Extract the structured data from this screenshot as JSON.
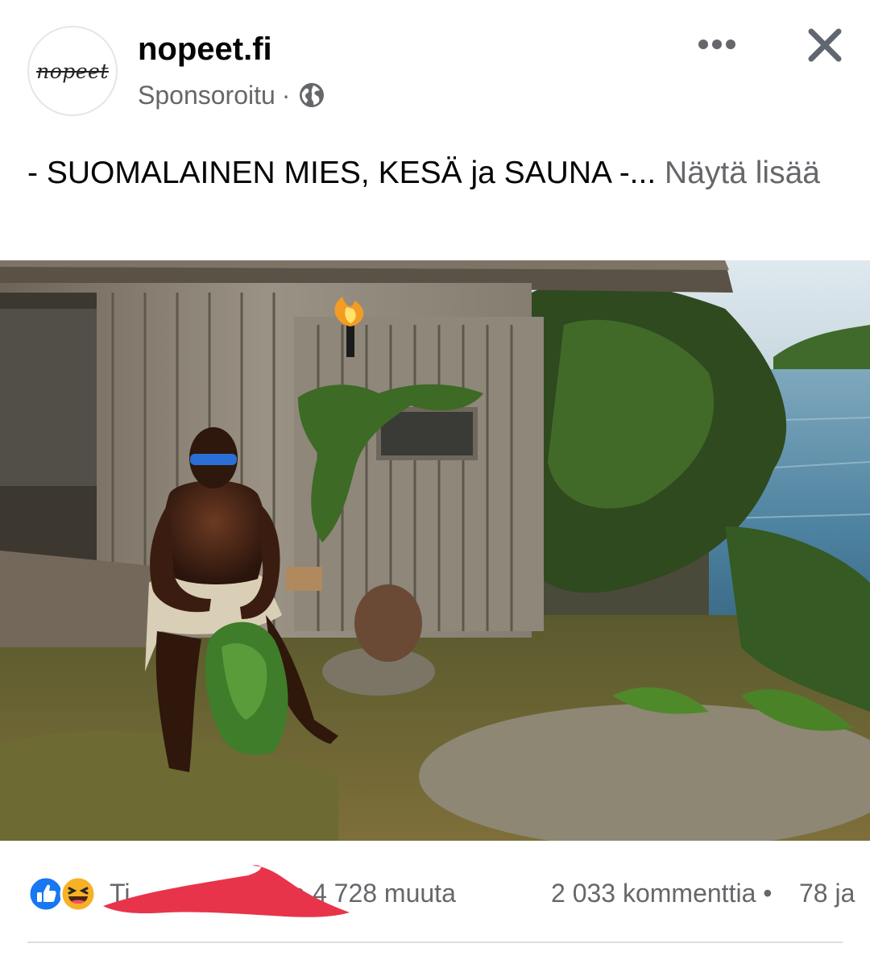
{
  "post": {
    "page_name": "nopeet.fi",
    "avatar_text": "nopeet",
    "sponsored_label": "Sponsoroitu",
    "meta_separator": "·",
    "audience_icon": "globe-icon",
    "more_icon": "more-dots-icon",
    "close_icon": "close-icon",
    "caption": "- SUOMALAINEN MIES, KESÄ ja SAUNA -...",
    "see_more": "Näytä lisää",
    "photo_description_icon": "post-photo"
  },
  "reactions": {
    "icons": [
      "like-icon",
      "haha-icon"
    ],
    "reactors_prefix": "Ti",
    "reactors_suffix": "lto ja 4 728 muuta",
    "comments": "2 033 kommenttia",
    "separator": "•",
    "shares": "78 ja"
  },
  "colors": {
    "text_primary": "#050505",
    "text_secondary": "#65676b",
    "like_blue": "#1877f2",
    "haha_yellow": "#f7b125",
    "redaction_red": "#e8344a",
    "divider": "#dadde1"
  }
}
